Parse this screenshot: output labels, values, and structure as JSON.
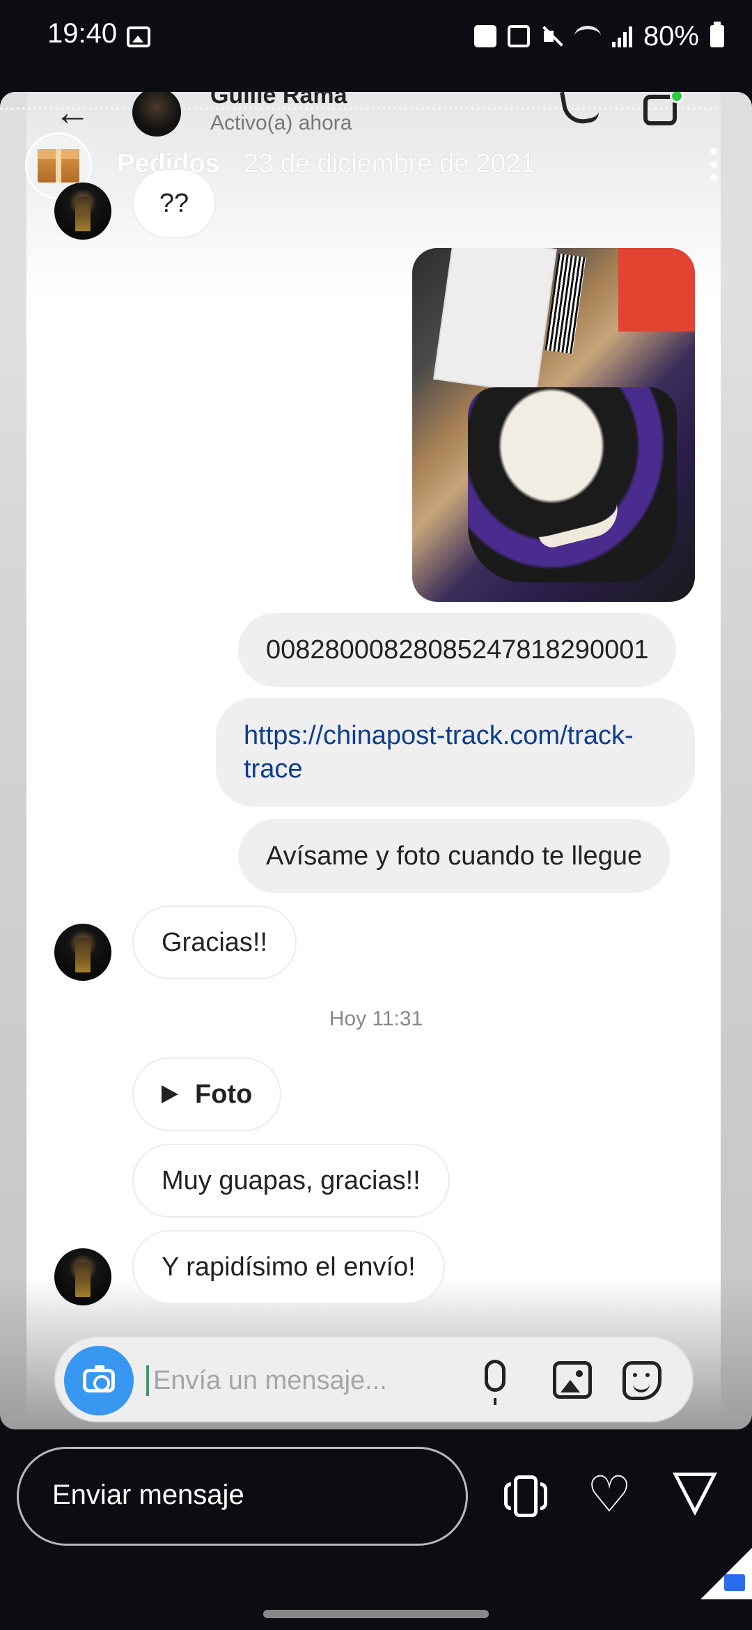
{
  "status_bar": {
    "time": "19:40",
    "battery": "80%",
    "icons": [
      "gallery-icon",
      "upload-icon",
      "nfc-icon",
      "mute-icon",
      "wifi-icon",
      "signal-icon",
      "battery-icon"
    ]
  },
  "dm_header": {
    "name": "Guille Rama",
    "status": "Activo(a) ahora"
  },
  "story": {
    "username": "Pedidos",
    "date": "23 de diciembre de 2021"
  },
  "messages": {
    "q": "??",
    "tracking_number": "00828000828085247818290001",
    "link": "https://chinapost-track.com/track-trace",
    "avisame": "Avísame y foto cuando te llegue",
    "gracias": "Gracias!!",
    "time_label": "Hoy 11:31",
    "foto": "Foto",
    "guapas": "Muy guapas, gracias!!",
    "rapidisimo": "Y rapidísimo el envío!"
  },
  "composer": {
    "placeholder": "Envía un mensaje..."
  },
  "reply_bar": {
    "label": "Enviar mensaje"
  },
  "colors": {
    "accent_blue": "#3897f0",
    "link": "#0b3d91",
    "online": "#2ecc40"
  }
}
